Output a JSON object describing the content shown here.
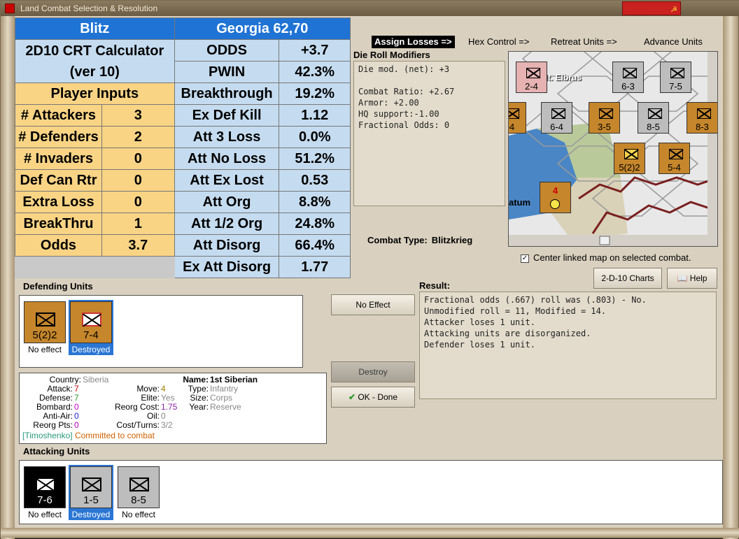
{
  "window": {
    "title": "Land Combat Selection & Resolution"
  },
  "calc": {
    "left_title": "Blitz",
    "right_title": "Georgia 62,70",
    "subtitle1": "2D10 CRT Calculator",
    "subtitle2": "(ver 10)",
    "player_inputs": "Player Inputs",
    "inputs": [
      {
        "label": "# Attackers",
        "value": "3"
      },
      {
        "label": "# Defenders",
        "value": "2"
      },
      {
        "label": "# Invaders",
        "value": "0"
      },
      {
        "label": "Def Can Rtr",
        "value": "0"
      },
      {
        "label": "Extra Loss",
        "value": "0"
      },
      {
        "label": "BreakThru",
        "value": "1"
      },
      {
        "label": "Odds",
        "value": "3.7"
      }
    ],
    "results": [
      {
        "label": "ODDS",
        "value": "+3.7"
      },
      {
        "label": "PWIN",
        "value": "42.3%"
      },
      {
        "label": "Breakthrough",
        "value": "19.2%"
      },
      {
        "label": "Ex Def Kill",
        "value": "1.12"
      },
      {
        "label": "Att 3 Loss",
        "value": "0.0%"
      },
      {
        "label": "Att No Loss",
        "value": "51.2%"
      },
      {
        "label": "Att Ex Lost",
        "value": "0.53"
      },
      {
        "label": "Att Org",
        "value": "8.8%"
      },
      {
        "label": "Att 1/2 Org",
        "value": "24.8%"
      },
      {
        "label": "Att Disorg",
        "value": "66.4%"
      },
      {
        "label": "Ex Att Disorg",
        "value": "1.77"
      }
    ]
  },
  "actions": {
    "assign_losses": "Assign Losses =>",
    "hex_control": "Hex Control =>",
    "retreat_units": "Retreat Units =>",
    "advance_units": "Advance Units"
  },
  "die_roll": {
    "title": "Die Roll Modifiers",
    "lines": [
      "Die mod. (net): +3",
      "",
      "Combat Ratio: +2.67",
      "Armor: +2.00",
      "HQ support:-1.00",
      "Fractional Odds: 0"
    ]
  },
  "combat_type": {
    "label": "Combat Type:",
    "value": "Blitzkrieg"
  },
  "map": {
    "place_label": "Mt. Elbrus",
    "place_label2": "atum",
    "counters": [
      {
        "val": "2-4",
        "color": "pink"
      },
      {
        "val": "6-3",
        "color": "grey"
      },
      {
        "val": "7-5",
        "color": "grey"
      },
      {
        "val": "6-4",
        "color": "grey"
      },
      {
        "val": "3-5",
        "color": "orange"
      },
      {
        "val": "8-5",
        "color": "grey"
      },
      {
        "val": "5(2)2",
        "color": "orange"
      },
      {
        "val": "5-4",
        "color": "orange"
      },
      {
        "val": "4",
        "color": "orange"
      },
      {
        "val": "-4",
        "color": "orange"
      },
      {
        "val": "8-3",
        "color": "orange"
      }
    ]
  },
  "link_option": {
    "label": "Center linked map on selected combat.",
    "checked": "✓"
  },
  "buttons": {
    "charts": "2-D-10 Charts",
    "help": "Help",
    "no_effect": "No Effect",
    "destroy": "Destroy",
    "ok_done": "OK - Done"
  },
  "defending": {
    "header": "Defending Units",
    "units": [
      {
        "value": "5(2)2",
        "status": "No effect"
      },
      {
        "value": "7-4",
        "status": "Destroyed"
      }
    ]
  },
  "info": {
    "country_k": "Country:",
    "country_v": "Siberia",
    "attack_k": "Attack:",
    "attack_v": "7",
    "defense_k": "Defense:",
    "defense_v": "7",
    "bombard_k": "Bombard:",
    "bombard_v": "0",
    "antiair_k": "Anti-Air:",
    "antiair_v": "0",
    "reorg_k": "Reorg Pts:",
    "reorg_v": "0",
    "move_k": "Move:",
    "move_v": "4",
    "elite_k": "Elite:",
    "elite_v": "Yes",
    "reorgcost_k": "Reorg Cost:",
    "reorgcost_v": "1.75",
    "oil_k": "Oil:",
    "oil_v": "0",
    "cost_k": "Cost/Turns:",
    "cost_v": "3/2",
    "name_k": "Name:",
    "name_v": "1st Siberian",
    "type_k": "Type:",
    "type_v": "Infantry",
    "size_k": "Size:",
    "size_v": "Corps",
    "year_k": "Year:",
    "year_v": "Reserve",
    "commander": "[Timoshenko]",
    "committed": "Committed to combat"
  },
  "result": {
    "header": "Result:",
    "lines": [
      "Fractional odds (.667) roll was (.803)  - No.",
      "Unmodified roll = 11, Modified = 14.",
      "Attacker loses 1 unit.",
      "Attacking units are disorganized.",
      "Defender loses 1 unit."
    ]
  },
  "attacking": {
    "header": "Attacking Units",
    "units": [
      {
        "value": "7-6",
        "status": "No effect"
      },
      {
        "value": "1-5",
        "status": "Destroyed"
      },
      {
        "value": "8-5",
        "status": "No effect"
      }
    ]
  }
}
